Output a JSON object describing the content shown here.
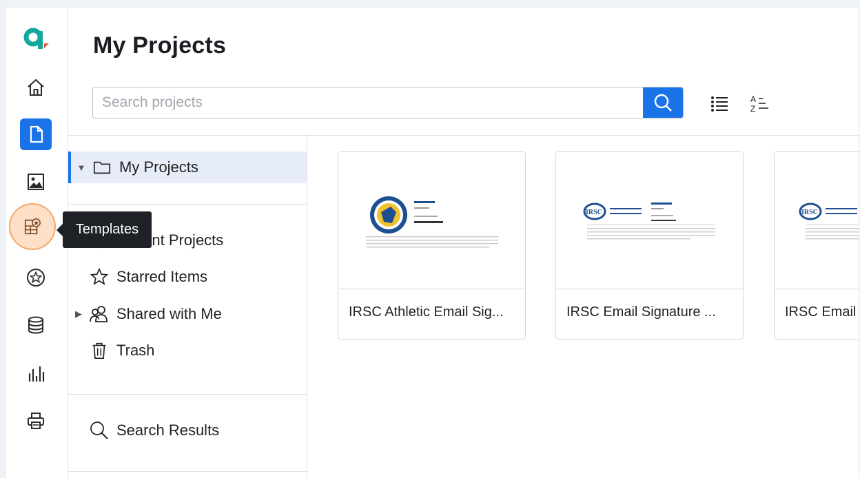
{
  "app": {
    "title": "My Projects",
    "search": {
      "placeholder": "Search projects",
      "value": ""
    },
    "tooltip": "Templates",
    "tree": {
      "my_projects": "My Projects",
      "recent_projects": "Recent Projects",
      "starred_items": "Starred Items",
      "shared_with_me": "Shared with Me",
      "trash": "Trash",
      "search_results": "Search Results"
    },
    "cards": [
      {
        "label": "IRSC Athletic Email Sig..."
      },
      {
        "label": "IRSC Email Signature ..."
      },
      {
        "label": "IRSC Email"
      }
    ],
    "rail_icons": [
      "logo-q",
      "home-icon",
      "document-icon",
      "image-icon",
      "templates-icon",
      "star-icon",
      "database-icon",
      "bar-chart-icon",
      "printer-icon"
    ]
  },
  "colors": {
    "accent": "#1a73e8",
    "logo_teal": "#12a89d",
    "logo_red": "#e8553f",
    "highlight": "#fde0c7",
    "tooltip_bg": "#1e2126"
  }
}
